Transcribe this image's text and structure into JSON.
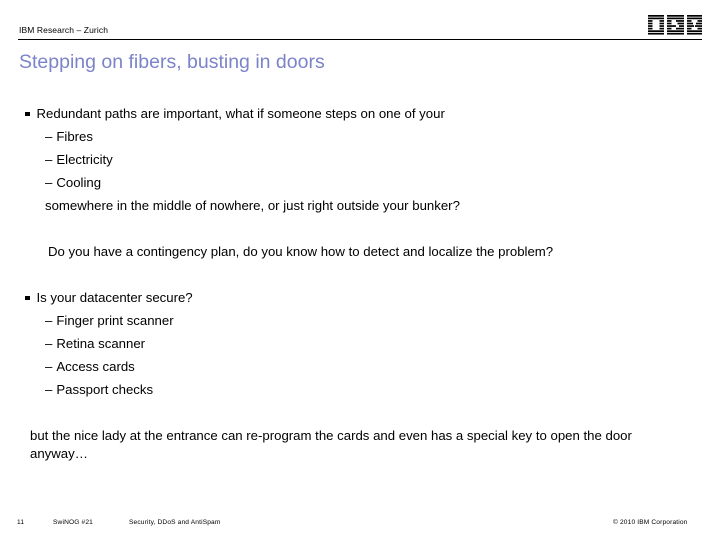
{
  "header": {
    "org_label": "IBM Research – Zurich",
    "logo_name": "ibm-logo"
  },
  "title": "Stepping on fibers, busting in doors",
  "title_color": "#7b84c8",
  "content": {
    "bullet_1": {
      "text": "Redundant paths are important, what if someone steps on one of your",
      "sub_items": [
        "Fibres",
        "Electricity",
        "Cooling"
      ],
      "continuation": "somewhere in the middle of nowhere, or just right outside your bunker?"
    },
    "paragraph_1": "Do you have a contingency plan, do you know how to detect and localize the problem?",
    "bullet_2": {
      "text": "Is your datacenter secure?",
      "sub_items": [
        "Finger print scanner",
        "Retina scanner",
        "Access cards",
        "Passport checks"
      ]
    },
    "paragraph_2": "but the nice lady at the entrance can re-program the cards and even has a special key to open the door anyway…"
  },
  "footer": {
    "page_number": "11",
    "event": "SwiNOG #21",
    "deck_title": "Security, DDoS and AntiSpam",
    "copyright": "© 2010 IBM Corporation"
  }
}
